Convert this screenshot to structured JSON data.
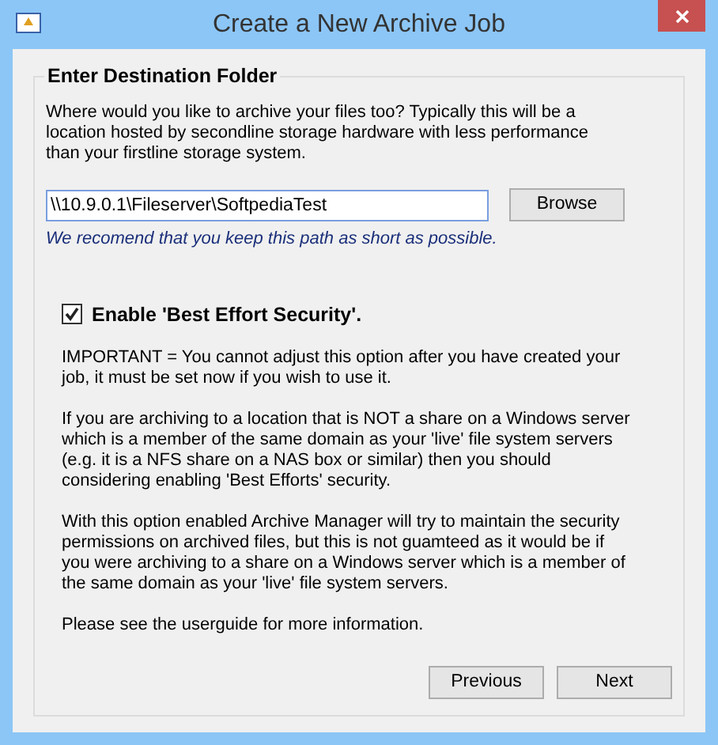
{
  "window": {
    "title": "Create a New Archive Job"
  },
  "group": {
    "title": "Enter Destination Folder"
  },
  "intro": "Where would you like to archive your files too? Typically this will be a location hosted by secondline storage hardware with less performance than your firstline storage system.",
  "path_field": {
    "value": "\\\\10.9.0.1\\Fileserver\\SoftpediaTest"
  },
  "browse_button": "Browse",
  "hint": "We recomend that you keep this path as short as possible.",
  "best_effort": {
    "label": "Enable 'Best Effort Security'.",
    "checked": true
  },
  "paragraphs": [
    "IMPORTANT = You cannot adjust this option after you have created your job, it must be set now if you wish to use it.",
    "If you are archiving to a location that is NOT a share on a Windows server which is a member of the same domain as your 'live' file system servers (e.g. it is a NFS share on a NAS box or similar) then you should considering enabling 'Best Efforts' security.",
    "With this option enabled Archive Manager will try to maintain the security permissions on archived files, but this is not guamteed as it would be if you were archiving to a share on a Windows server which is a member of the same domain as your 'live' file system servers.",
    "Please see the userguide for more information."
  ],
  "buttons": [
    "Previous",
    "Next"
  ]
}
